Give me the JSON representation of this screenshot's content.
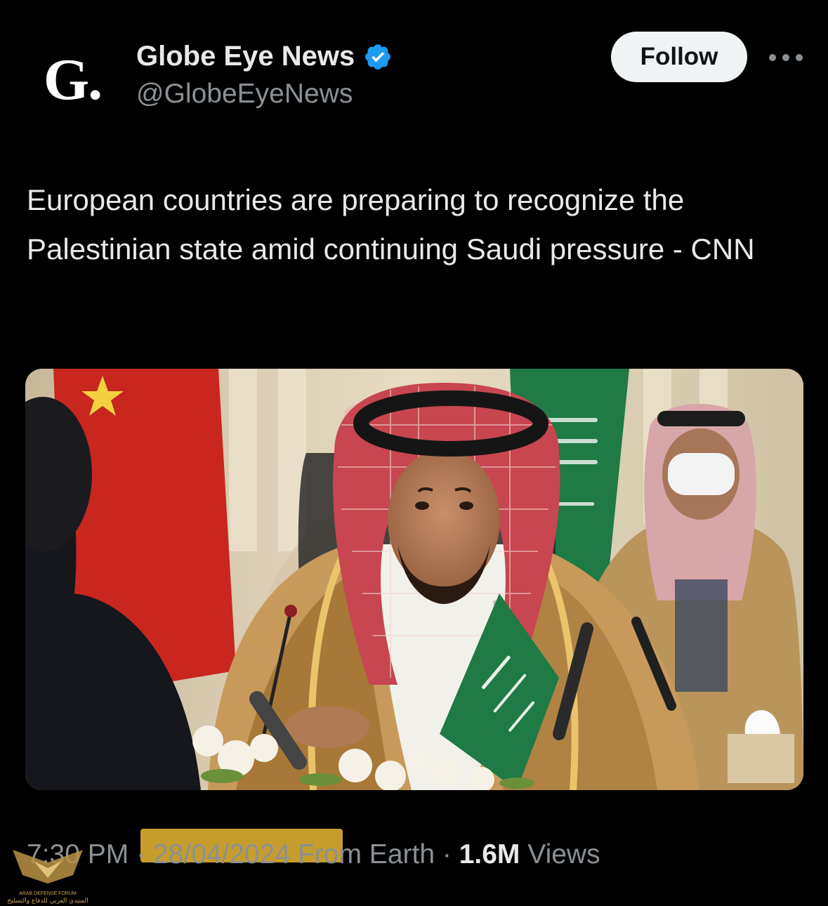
{
  "author": {
    "avatar_letter": "G.",
    "display_name": "Globe Eye News",
    "handle": "@GlobeEyeNews",
    "verified": true,
    "verified_color": "#1d9bf0"
  },
  "actions": {
    "follow_label": "Follow",
    "more_icon": "more-horizontal-icon"
  },
  "post": {
    "text": "European countries are preparing to recognize the Palestinian state amid continuing Saudi pressure - CNN"
  },
  "meta": {
    "time": "7:30 PM",
    "separator": "·",
    "date": "28/04/2024",
    "source": "From Earth",
    "views_count": "1.6M",
    "views_label": "Views"
  },
  "watermark": {
    "line1": "ARAB DEFENSE FORUM",
    "line2": "المنتدى العربي للدفاع والتسليح"
  },
  "colors": {
    "background": "#000000",
    "text_primary": "#e7e9ea",
    "text_secondary": "#8b9095",
    "follow_bg": "#eff3f4",
    "highlight": "#e9b934"
  }
}
